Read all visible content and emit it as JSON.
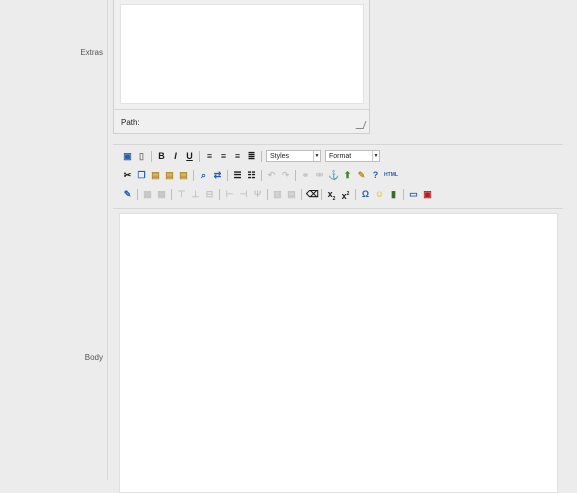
{
  "labels": {
    "extras": "Extras",
    "body": "Body"
  },
  "extras_editor": {
    "path_label": "Path:"
  },
  "toolbar": {
    "styles_select": "Styles",
    "format_select": "Format",
    "html_button": "HTML",
    "bold": "B",
    "italic": "I",
    "underline": "U",
    "omega": "Ω",
    "subscript": "x",
    "superscript": "x"
  },
  "colors": {
    "background": "#ececec",
    "editor_bg": "#ffffff",
    "border": "#d6d6d6"
  }
}
